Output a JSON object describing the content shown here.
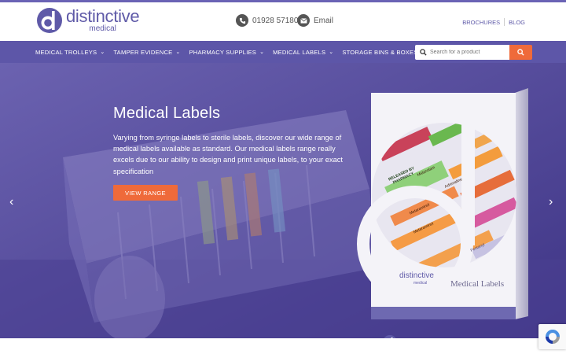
{
  "brand": {
    "name": "distinctive",
    "sub": "medical",
    "colors": {
      "primary": "#5f5aa8",
      "nav": "#5d56a8",
      "accent": "#ef6a3a"
    }
  },
  "contact": {
    "phone": "01928 571801",
    "email": "Email",
    "phone_icon": "phone-icon",
    "email_icon": "envelope-icon"
  },
  "toplinks": {
    "brochures": "BROCHURES",
    "blog": "BLOG"
  },
  "nav": {
    "items": [
      {
        "label": "MEDICAL TROLLEYS"
      },
      {
        "label": "TAMPER EVIDENCE"
      },
      {
        "label": "PHARMACY SUPPLIES"
      },
      {
        "label": "MEDICAL LABELS"
      },
      {
        "label": "STORAGE BINS & BOXES"
      }
    ],
    "chevron": "⌄"
  },
  "search": {
    "placeholder": "Search for a product",
    "value": ""
  },
  "hero": {
    "title": "Medical Labels",
    "description": "Varying from syringe labels to sterile labels, discover our wide range of medical labels available as standard. Our medical labels range really excels due to our ability to design and print unique labels, to your exact specification",
    "button": "VIEW RANGE",
    "prev": "‹",
    "next": "›",
    "book": {
      "brand": "distinctive",
      "brand_sub": "medical",
      "title": "Medical Labels",
      "labels": [
        "RELEASED BY PHARMACY",
        "Midazolam",
        "Metaraminol",
        "Adrenaline",
        "Metaraminol",
        "Fentanyl"
      ]
    }
  }
}
